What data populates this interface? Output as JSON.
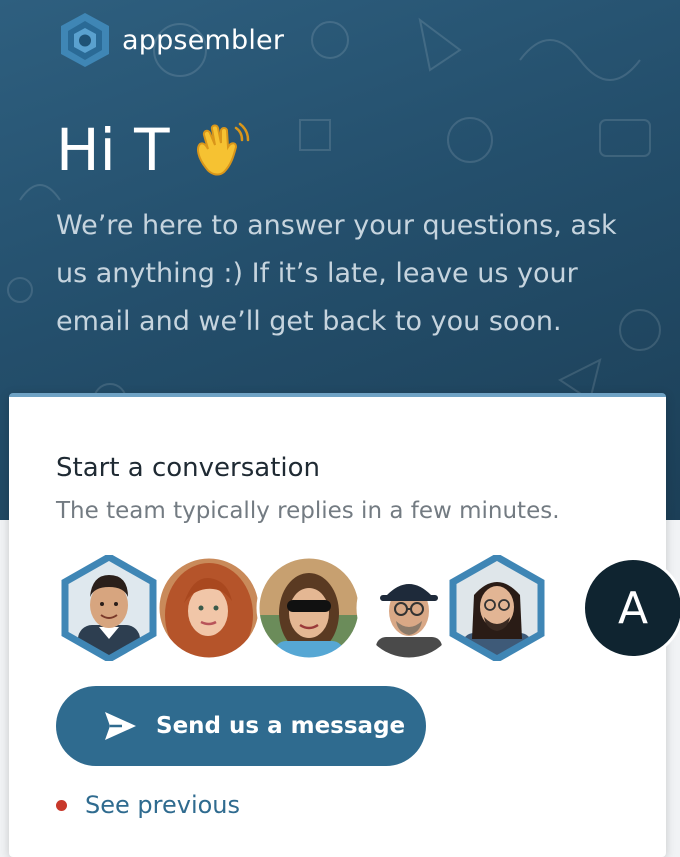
{
  "header": {
    "brand_name": "appsembler",
    "greeting": "Hi T",
    "greeting_emoji": "waving-hand-icon",
    "intro": "We’re here to answer your questions, ask us anything :) If it’s late, leave us your email and we’ll get back to you soon."
  },
  "card": {
    "title": "Start a conversation",
    "subtitle": "The team typically replies in a few minutes.",
    "avatars": [
      {
        "kind": "photo",
        "shape": "hexagon"
      },
      {
        "kind": "photo",
        "shape": "circle"
      },
      {
        "kind": "photo",
        "shape": "circle"
      },
      {
        "kind": "photo",
        "shape": "circle"
      },
      {
        "kind": "photo",
        "shape": "hexagon"
      },
      {
        "kind": "initial",
        "initial": "A"
      }
    ],
    "send_button_label": "Send us a message",
    "send_icon": "paper-plane-icon",
    "see_previous_label": "See previous"
  },
  "colors": {
    "hero": "#244f6c",
    "accent": "#2f6b8f",
    "unread_dot": "#c8382b",
    "avatar_initial_bg": "#0f2430"
  }
}
